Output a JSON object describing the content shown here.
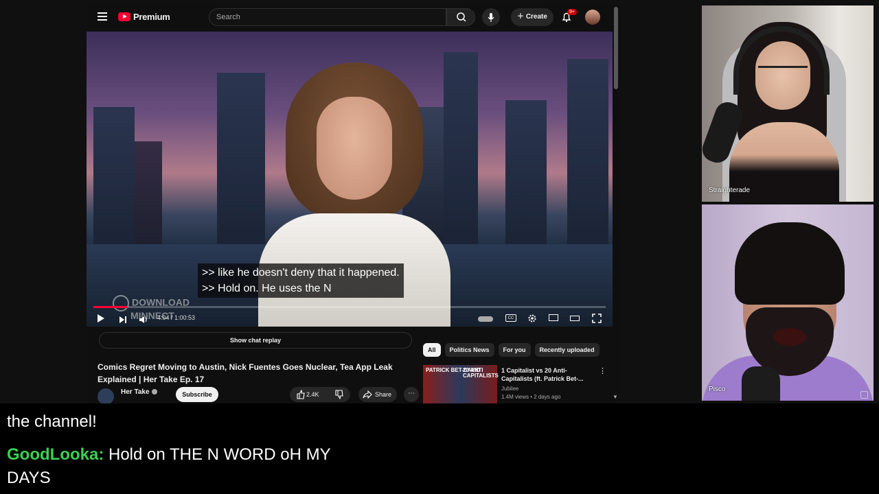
{
  "youtube": {
    "logo_text": "Premium",
    "search_placeholder": "Search",
    "create_label": "Create",
    "notification_badge": "9+",
    "player": {
      "caption_line1": ">> like he doesn't deny that it happened.",
      "caption_line2": ">> Hold on. He uses the N",
      "watermark_line1": "DOWNLOAD",
      "watermark_line2": "MINNECT",
      "time": "4:04 / 1:00:53",
      "progress": 0.067,
      "cc_label": "CC"
    },
    "show_chat_replay": "Show chat replay",
    "video_title": "Comics Regret Moving to Austin, Nick Fuentes Goes Nuclear, Tea App Leak Explained | Her Take Ep. 17",
    "channel": {
      "name": "Her Take",
      "subscribe": "Subscribe",
      "likes": "2.4K",
      "share": "Share",
      "more": "⋯"
    },
    "chips": [
      "All",
      "Politics News",
      "For you",
      "Recently uploaded"
    ],
    "recommendation": {
      "thumb_left": "PATRICK BET-DAVID",
      "thumb_right": "20 ANTI CAPITALISTS",
      "title": "1 Capitalist vs 20 Anti-Capitalists (ft. Patrick Bet-...",
      "channel": "Jubilee",
      "meta": "1.4M views • 2 days ago"
    }
  },
  "cams": {
    "top_label": "Straighterade",
    "bottom_label": "Pisco"
  },
  "chat": {
    "line1": "the channel!",
    "user": "GoodLooka:",
    "message_line1": " Hold on THE N WORD oH MY",
    "message_line2": "DAYS",
    "user_color": "#39d153"
  }
}
